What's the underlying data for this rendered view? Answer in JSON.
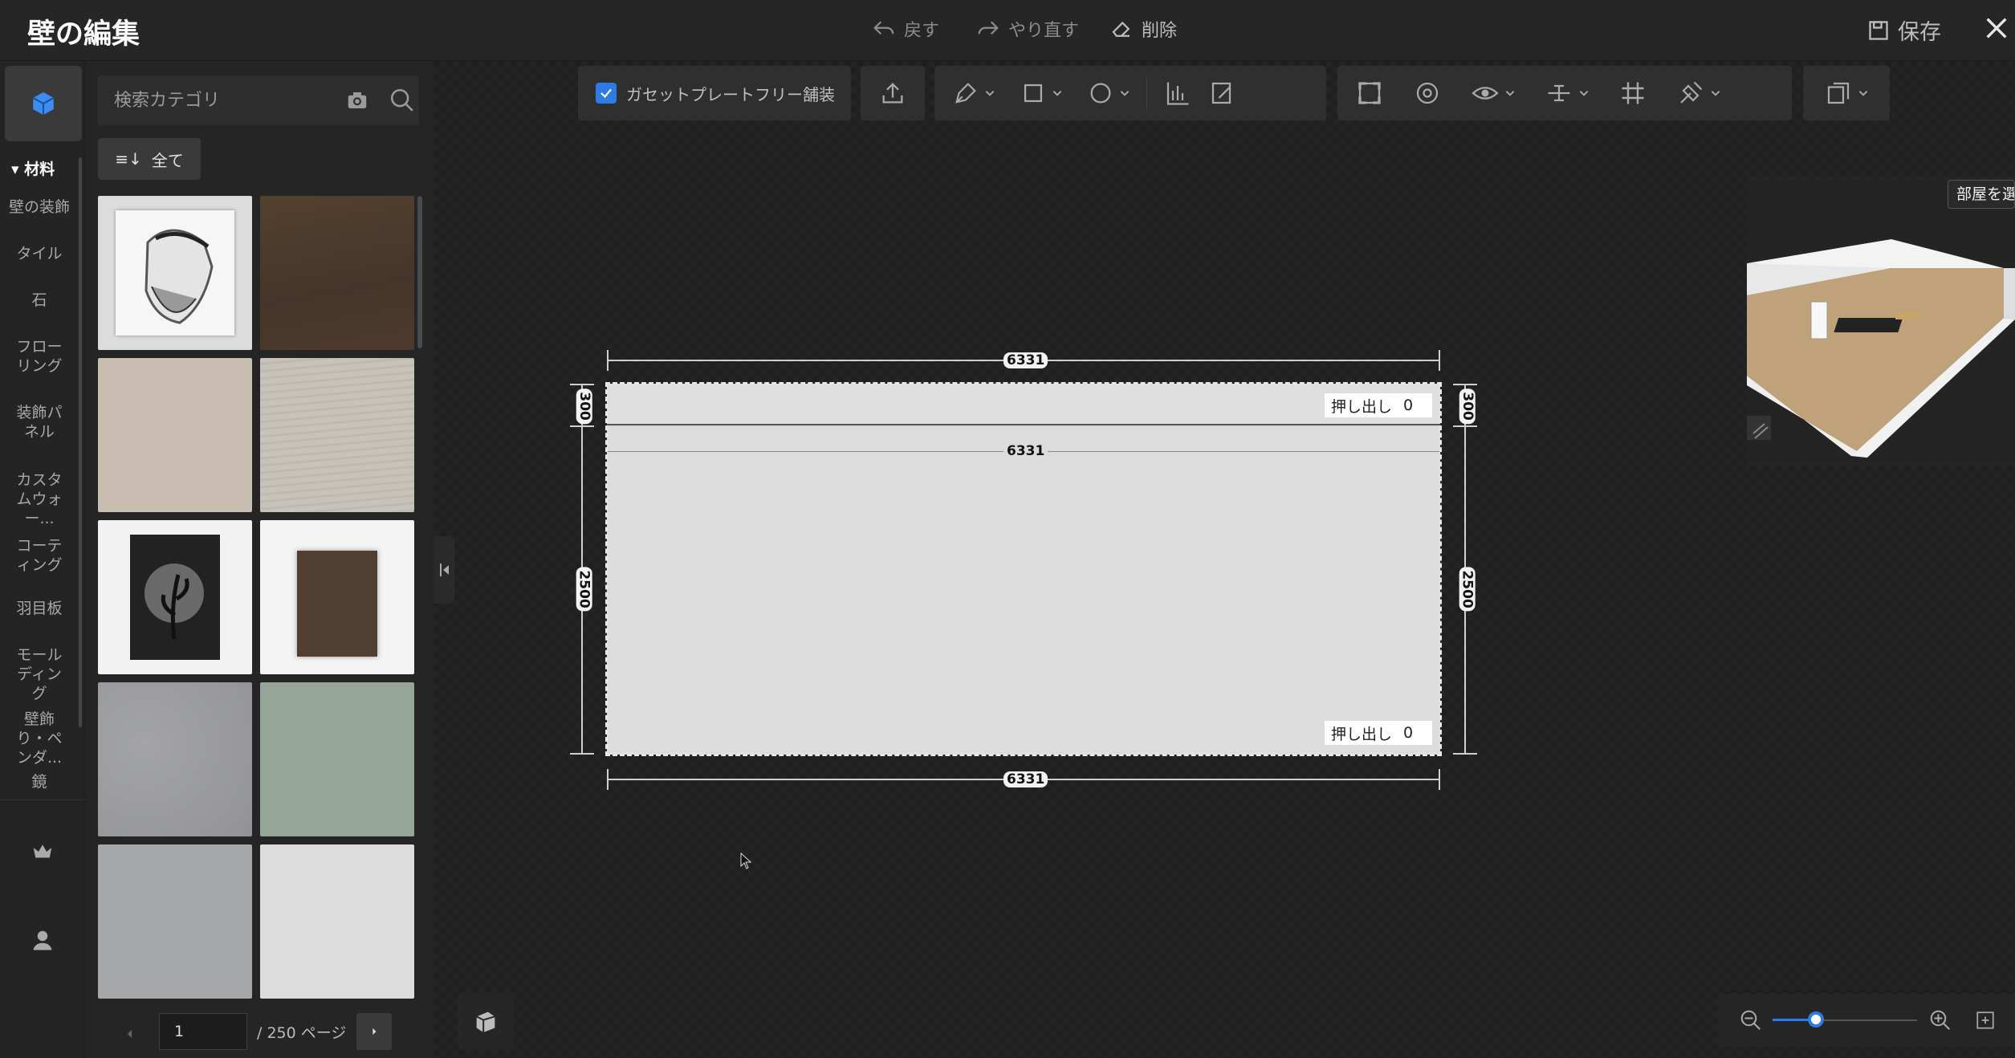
{
  "app": {
    "title": "壁の編集"
  },
  "titlebar": {
    "undo_label": "戻す",
    "redo_label": "やり直す",
    "delete_label": "削除",
    "save_label": "保存"
  },
  "search": {
    "placeholder": "検索カテゴリ"
  },
  "filter": {
    "label": "全て"
  },
  "sidebar": {
    "section_label": "材料",
    "items": [
      {
        "label": "壁の装飾"
      },
      {
        "label": "タイル"
      },
      {
        "label": "石"
      },
      {
        "label": "フローリング"
      },
      {
        "label": "装飾パネル"
      },
      {
        "label": "カスタムウォー..."
      },
      {
        "label": "コーティング"
      },
      {
        "label": "羽目板"
      },
      {
        "label": "モールディング"
      },
      {
        "label": "壁飾り・ペンダ..."
      },
      {
        "label": "鏡"
      }
    ]
  },
  "materials": [
    {
      "name": "bearded-man-sketch",
      "color": "#e9e9e9"
    },
    {
      "name": "dark-wood",
      "color": "#4e3a2d"
    },
    {
      "name": "beige-plaster",
      "color": "#c8bdb0"
    },
    {
      "name": "white-wash-wood",
      "color": "#c7c3bb"
    },
    {
      "name": "leaf-art-frame",
      "color": "#f2f2f2"
    },
    {
      "name": "wood-panel-frame",
      "color": "#f4f4f4"
    },
    {
      "name": "grey-concrete",
      "color": "#9a9b9e"
    },
    {
      "name": "sage-green",
      "color": "#95a597"
    },
    {
      "name": "mid-grey",
      "color": "#a6a7a9"
    },
    {
      "name": "light-grey",
      "color": "#dcdcdc"
    }
  ],
  "pager": {
    "current": "1",
    "total_label": "/ 250 ページ"
  },
  "toolbar": {
    "gusset_label": "ガセットプレートフリー舗装",
    "gusset_checked": true
  },
  "wall": {
    "width_top": "6331",
    "width_inner": "6331",
    "width_bottom": "6331",
    "height_top_left": "300",
    "height_main_left": "2500",
    "height_top_right": "300",
    "height_main_right": "2500",
    "extrude_label": "押し出し",
    "extrude_top_value": "0",
    "extrude_bottom_value": "0"
  },
  "preview": {
    "room_button": "部屋を選"
  },
  "zoom": {
    "level": 0.3
  },
  "colors": {
    "accent": "#2f7be6",
    "bg": "#1c1c1c",
    "panel": "#252525"
  }
}
